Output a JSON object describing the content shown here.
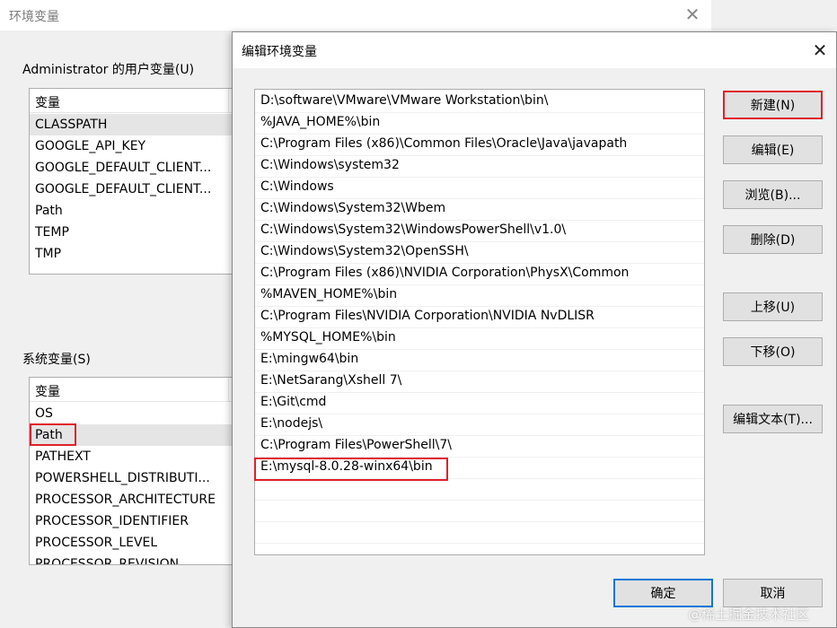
{
  "background_window": {
    "title": "环境变量",
    "user_section_label": "Administrator 的用户变量(U)",
    "user_vars_header": "变量",
    "user_vars": [
      "CLASSPATH",
      "GOOGLE_API_KEY",
      "GOOGLE_DEFAULT_CLIENT...",
      "GOOGLE_DEFAULT_CLIENT...",
      "Path",
      "TEMP",
      "TMP"
    ],
    "system_section_label": "系统变量(S)",
    "system_vars_header": "变量",
    "system_vars": [
      "OS",
      "Path",
      "PATHEXT",
      "POWERSHELL_DISTRIBUTI...",
      "PROCESSOR_ARCHITECTURE",
      "PROCESSOR_IDENTIFIER",
      "PROCESSOR_LEVEL",
      "PROCESSOR_REVISION"
    ]
  },
  "dialog": {
    "title": "编辑环境变量",
    "paths": [
      "D:\\software\\VMware\\VMware Workstation\\bin\\",
      "%JAVA_HOME%\\bin",
      "C:\\Program Files (x86)\\Common Files\\Oracle\\Java\\javapath",
      "C:\\Windows\\system32",
      "C:\\Windows",
      "C:\\Windows\\System32\\Wbem",
      "C:\\Windows\\System32\\WindowsPowerShell\\v1.0\\",
      "C:\\Windows\\System32\\OpenSSH\\",
      "C:\\Program Files (x86)\\NVIDIA Corporation\\PhysX\\Common",
      "%MAVEN_HOME%\\bin",
      "C:\\Program Files\\NVIDIA Corporation\\NVIDIA NvDLISR",
      "%MYSQL_HOME%\\bin",
      "E:\\mingw64\\bin",
      "E:\\NetSarang\\Xshell 7\\",
      "E:\\Git\\cmd",
      "E:\\nodejs\\",
      "C:\\Program Files\\PowerShell\\7\\",
      "E:\\mysql-8.0.28-winx64\\bin"
    ],
    "buttons": {
      "new": "新建(N)",
      "edit": "编辑(E)",
      "browse": "浏览(B)...",
      "delete": "删除(D)",
      "move_up": "上移(U)",
      "move_down": "下移(O)",
      "edit_text": "编辑文本(T)...",
      "ok": "确定",
      "cancel": "取消"
    }
  },
  "watermark": "@稀土掘金技术社区",
  "colors": {
    "highlight_red": "#e0202a",
    "accent_blue": "#0078d7",
    "window_bg": "#f0f0f0"
  }
}
